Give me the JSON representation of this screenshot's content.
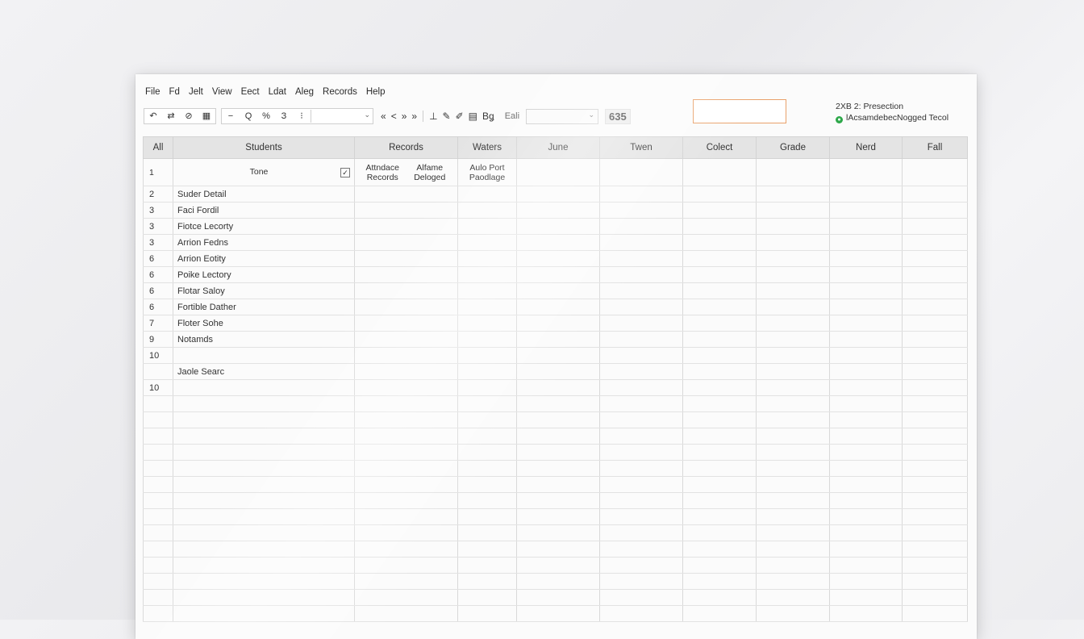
{
  "menu": [
    "File",
    "Fd",
    "Jelt",
    "View",
    "Eect",
    "Ldat",
    "Aleg",
    "Records",
    "Help"
  ],
  "toolbar": {
    "group1": [
      "↶",
      "⇄",
      "⊘",
      "▦"
    ],
    "group2": [
      "−",
      "Q",
      "%",
      "З",
      "⁝"
    ],
    "nav": [
      "«",
      "<",
      "»",
      "»"
    ],
    "tools": [
      "⊥",
      "✎",
      "✐",
      "▤",
      "Bǥ"
    ],
    "format_label": "Eali",
    "counter": "635"
  },
  "status": {
    "line1": "2XB 2: Presection",
    "line2": "lAcsamdebecNogged Tecol",
    "indicator_color": "#2ea84a"
  },
  "grid": {
    "headers": [
      "All",
      "Students",
      "Records",
      "Waters",
      "June",
      "Twen",
      "Colect",
      "Grade",
      "Nerd",
      "Fall"
    ],
    "subrow": {
      "num": "1",
      "name": "Tone",
      "checkbox": "✓",
      "c1": "Attndace Records",
      "c2": "Alfame Deloged",
      "c3": "Aulo Port Paodlage"
    },
    "rows": [
      {
        "num": "2",
        "name": "Suder Detail"
      },
      {
        "num": "3",
        "name": "Faci Fordil"
      },
      {
        "num": "3",
        "name": "Fiotce Lecorty"
      },
      {
        "num": "3",
        "name": "Arrion Fedns"
      },
      {
        "num": "6",
        "name": "Arrion Eotity"
      },
      {
        "num": "6",
        "name": "Poike Lectory"
      },
      {
        "num": "6",
        "name": "Flotar Saloy"
      },
      {
        "num": "6",
        "name": "Fortible Dather"
      },
      {
        "num": "7",
        "name": "Floter Sohe"
      },
      {
        "num": "9",
        "name": "Notamds"
      },
      {
        "num": "10",
        "name": ""
      },
      {
        "num": "",
        "name": "Jaole Searc"
      },
      {
        "num": "10",
        "name": ""
      },
      {
        "num": "",
        "name": ""
      },
      {
        "num": "",
        "name": ""
      },
      {
        "num": "",
        "name": ""
      },
      {
        "num": "",
        "name": ""
      },
      {
        "num": "",
        "name": ""
      },
      {
        "num": "",
        "name": ""
      },
      {
        "num": "",
        "name": ""
      },
      {
        "num": "",
        "name": ""
      },
      {
        "num": "",
        "name": ""
      },
      {
        "num": "",
        "name": ""
      },
      {
        "num": "",
        "name": ""
      },
      {
        "num": "",
        "name": ""
      },
      {
        "num": "",
        "name": ""
      },
      {
        "num": "",
        "name": ""
      }
    ]
  }
}
